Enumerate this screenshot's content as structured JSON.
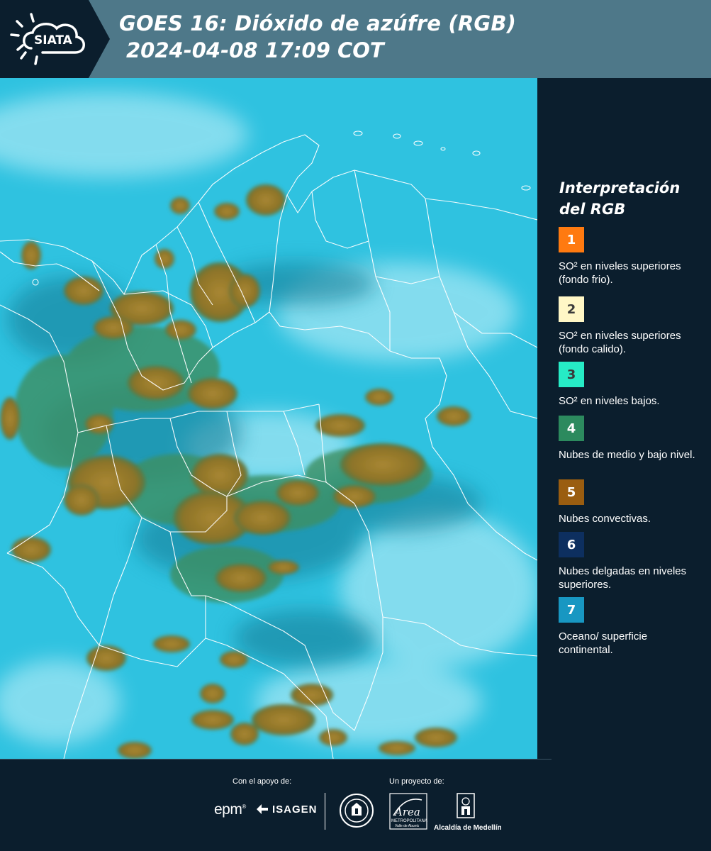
{
  "header": {
    "logo_text": "SIATA",
    "title_line1": "GOES 16: Dióxido de azúfre (RGB)",
    "title_line2": "2024-04-08 17:09 COT"
  },
  "legend": {
    "title": "Interpretación del RGB",
    "items": [
      {
        "number": "1",
        "color": "#ff7a10",
        "text_color": "#ffffff",
        "label": "SO² en niveles superiores (fondo frio)."
      },
      {
        "number": "2",
        "color": "#fff7c6",
        "text_color": "#3a3a3a",
        "label": "SO² en niveles superiores (fondo calido)."
      },
      {
        "number": "3",
        "color": "#26ecc6",
        "text_color": "#3a3a3a",
        "label": "SO² en niveles bajos."
      },
      {
        "number": "4",
        "color": "#2c8a5e",
        "text_color": "#ffffff",
        "label": "Nubes de medio y bajo nivel."
      },
      {
        "number": "5",
        "color": "#9a5d10",
        "text_color": "#ffffff",
        "label": "Nubes convectivas."
      },
      {
        "number": "6",
        "color": "#0d2f5f",
        "text_color": "#ffffff",
        "label": "Nubes delgadas en niveles superiores."
      },
      {
        "number": "7",
        "color": "#1897c2",
        "text_color": "#ffffff",
        "label": "Oceano/ superficie continental."
      }
    ]
  },
  "map": {
    "ocean_color": "#2fc2e0",
    "cloud_color": "#9a7a2a",
    "border_color": "#ffffff"
  },
  "footer": {
    "support_label": "Con el apoyo de:",
    "project_label": "Un proyecto de:",
    "epm": "epm",
    "isagen": "ISAGEN",
    "area_name": "Área",
    "area_sub": "METROPOLITANA",
    "area_sub2": "Valle de Aburrá",
    "alcaldia": "Alcaldía de Medellín"
  }
}
